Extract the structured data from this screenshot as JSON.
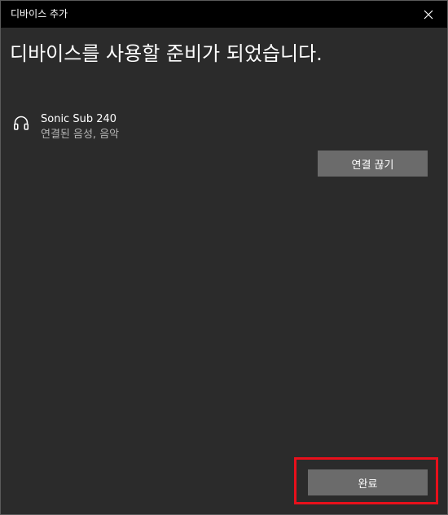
{
  "window": {
    "title": "디바이스 추가"
  },
  "main": {
    "heading": "디바이스를 사용할 준비가 되었습니다."
  },
  "device": {
    "icon": "headphones-icon",
    "name": "Sonic Sub 240",
    "status": "연결된 음성, 음악"
  },
  "buttons": {
    "disconnect_label": "연결 끊기",
    "done_label": "완료"
  },
  "colors": {
    "background": "#2b2b2b",
    "titlebar": "#000000",
    "button": "#6b6b6b",
    "highlight": "#e8101b"
  }
}
